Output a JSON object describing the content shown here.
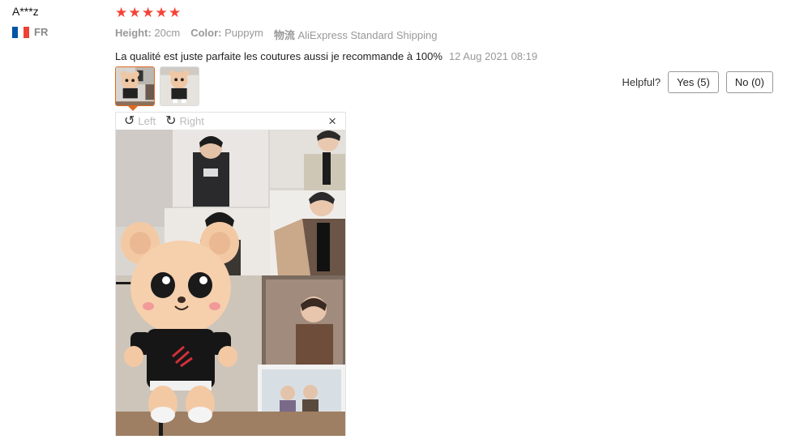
{
  "reviewer": {
    "name": "A***z",
    "country_code": "FR",
    "flag_colors": [
      "#0055A4",
      "#FFFFFF",
      "#EF4135"
    ]
  },
  "rating": {
    "stars": 5,
    "star_glyph": "★",
    "color": "#f44336"
  },
  "attributes": [
    {
      "key": "Height:",
      "value": "20cm"
    },
    {
      "key": "Color:",
      "value": "Puppym"
    },
    {
      "key": "物流",
      "value": "AliExpress Standard Shipping"
    }
  ],
  "feedback": {
    "text": "La qualité est juste parfaite les coutures aussi je recommande à 100%",
    "date": "12 Aug 2021 08:19"
  },
  "helpful": {
    "label": "Helpful?",
    "yes": "Yes (5)",
    "no": "No (0)"
  },
  "viewer": {
    "rotate_left": "Left",
    "rotate_right": "Right",
    "rotate_left_icon": "↺",
    "rotate_right_icon": "↻",
    "close_icon": "×"
  },
  "accent_color": "#e06a21"
}
